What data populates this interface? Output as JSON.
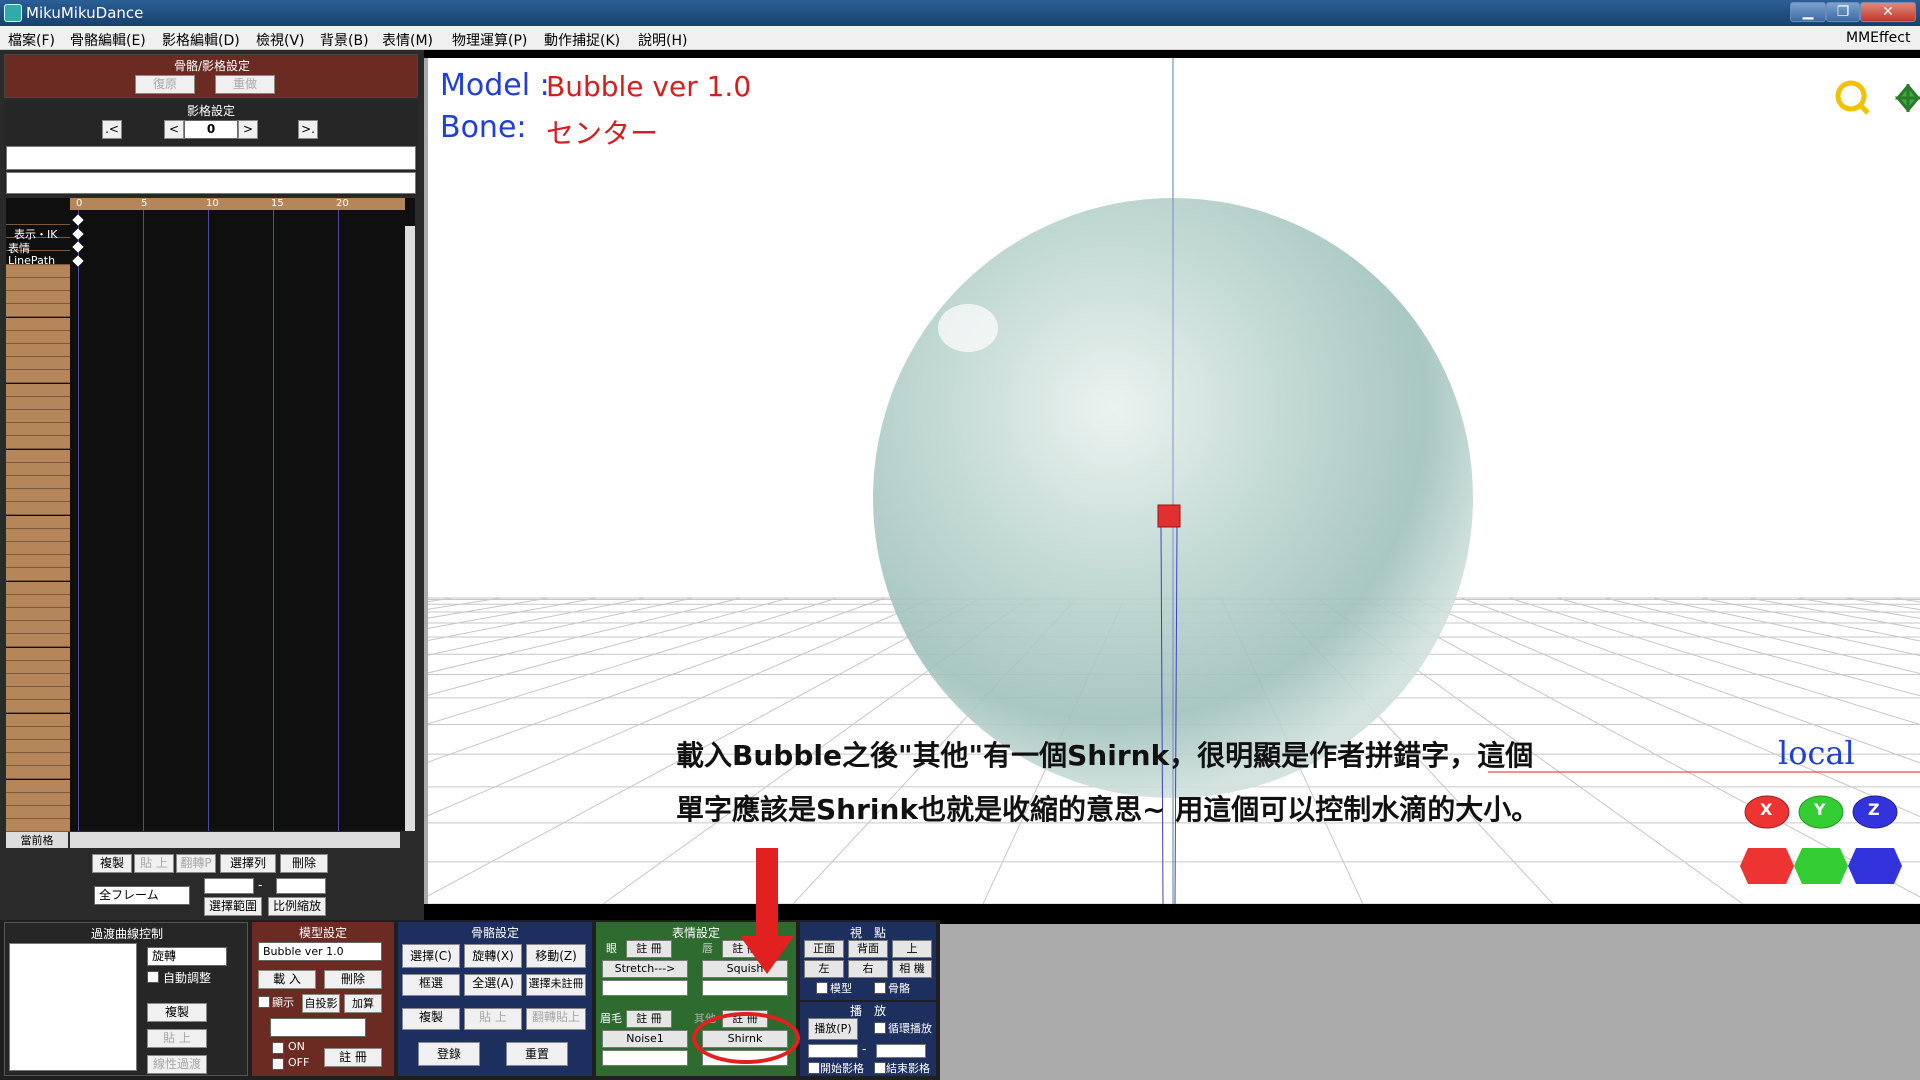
{
  "window": {
    "title": "MikuMikuDance",
    "min": "▁",
    "max": "❐",
    "close": "✕"
  },
  "menu": [
    "檔案(F)",
    "骨骼編輯(E)",
    "影格編輯(D)",
    "檢視(V)",
    "背景(B)",
    "表情(M)",
    "物理運算(P)",
    "動作捕捉(K)",
    "說明(H)"
  ],
  "menu_right": "MMEffect",
  "bone_frame_panel": {
    "title": "骨骼/影格設定",
    "restore": "復原",
    "redo": "重做"
  },
  "frame_panel": {
    "title": "影格設定",
    "prev_key": ".<",
    "prev": "<",
    "frame_value": "0",
    "next": ">",
    "next_key": ">."
  },
  "timeline": {
    "ticks": [
      "0",
      "5",
      "10",
      "15",
      "20"
    ],
    "labels": [
      "表示・IK",
      "表情",
      "LinePath"
    ],
    "current_frame_label": "當前格"
  },
  "edit_buttons": {
    "copy": "複製",
    "paste": "貼 上",
    "flip": "翻轉P",
    "select_column": "選擇列",
    "delete": "刪除",
    "select_range": "選擇範圍",
    "scale": "比例縮放",
    "frame_select": "全フレーム",
    "dash": "-"
  },
  "viewport": {
    "model_label": "Model :",
    "model_value": "Bubble ver 1.0",
    "bone_label": "Bone:",
    "bone_value": "センター",
    "local": "local",
    "note_line1": "載入Bubble之後\"其他\"有一個Shirnk，很明顯是作者拼錯字，這個",
    "note_line2": "單字應該是Shrink也就是收縮的意思~ 用這個可以控制水滴的大小。",
    "axis_labels": [
      "X",
      "Y",
      "Z"
    ]
  },
  "interp_panel": {
    "title": "過渡曲線控制",
    "select": "旋轉",
    "auto_adjust": "自動調整",
    "copy": "複製",
    "paste": "貼 上",
    "linear": "線性過渡"
  },
  "model_panel": {
    "title": "模型設定",
    "model_select": "Bubble ver 1.0",
    "load": "載 入",
    "delete": "刪除",
    "show": "顯示",
    "self_shadow": "自投影",
    "add": "加算",
    "on": "ON",
    "off": "OFF",
    "register": "註 冊"
  },
  "bone_panel": {
    "title": "骨骼設定",
    "select": "選擇(C)",
    "rotate": "旋轉(X)",
    "move": "移動(Z)",
    "box_select": "框選",
    "select_all": "全選(A)",
    "select_unreg": "選擇未註冊",
    "copy": "複製",
    "paste": "貼 上",
    "flip_paste": "翻轉貼上",
    "register": "登錄",
    "reset": "重置"
  },
  "morph_panel": {
    "title": "表情設定",
    "eye": "眼",
    "lip": "唇",
    "brow": "眉毛",
    "other": "其他",
    "register": "註 冊",
    "eye_value": "Stretch--->",
    "lip_value": "Squish",
    "brow_value": "Noise1",
    "other_value": "Shirnk"
  },
  "view_panel": {
    "title": "視　點",
    "front": "正面",
    "back": "背面",
    "top": "上",
    "left": "左",
    "right": "右",
    "camera": "相 機",
    "model": "模型",
    "bone": "骨骼"
  },
  "play_panel": {
    "title": "播　放",
    "play": "播放(P)",
    "loop": "循環播放",
    "start_frame": "開始影格",
    "end_frame": "結束影格",
    "dash": "-"
  },
  "colors": {
    "accent_red": "#e32020",
    "maroon": "#6b2a22",
    "green": "#2e6b2e",
    "navy": "#1d2f5e"
  }
}
